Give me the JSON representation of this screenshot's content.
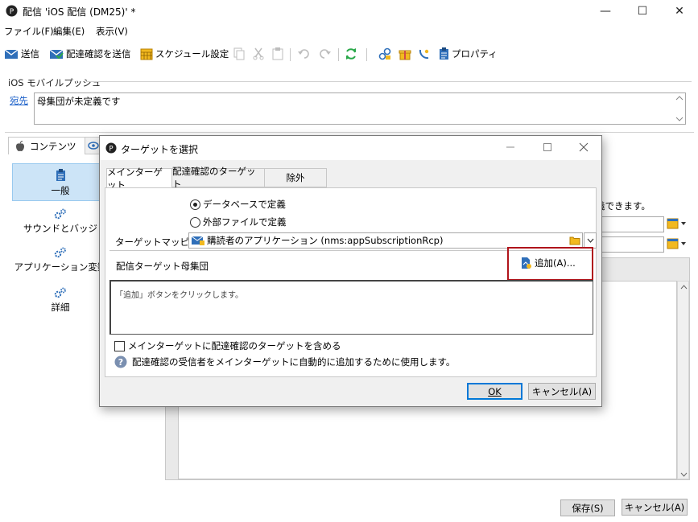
{
  "window": {
    "title": "配信 'iOS 配信 (DM25)' *",
    "minimize": "—",
    "maximize": "☐",
    "close": "✕"
  },
  "menu": [
    "ファイル(F)",
    "編集(E)",
    "表示(V)"
  ],
  "toolbar": {
    "send": "送信",
    "send_proof": "配達確認を送信",
    "schedule": "スケジュール設定",
    "properties": "プロパティ"
  },
  "section": {
    "title": "iOS モバイルプッシュ",
    "recipient_link": "宛先",
    "recipient_value": "母集団が未定義です"
  },
  "tabs": {
    "content": "コンテンツ"
  },
  "nav": [
    {
      "label": "一般",
      "icon": "clipboard-icon",
      "selected": true
    },
    {
      "label": "サウンドとバッジ",
      "icon": "gears-icon",
      "selected": false
    },
    {
      "label": "アプリケーション変数",
      "icon": "gears-icon",
      "selected": false
    },
    {
      "label": "詳細",
      "icon": "gears-icon",
      "selected": false
    }
  ],
  "background": {
    "hint_text": "義できます。"
  },
  "footer": {
    "save": "保存(S)",
    "cancel": "キャンセル(A)"
  },
  "dialog": {
    "title": "ターゲットを選択",
    "tabs": [
      "メインターゲット",
      "配達確認のターゲット",
      "除外"
    ],
    "active_tab": 0,
    "radio_db": "データベースで定義",
    "radio_file": "外部ファイルで定義",
    "radio_selected": "db",
    "mapping_label": "ターゲットマッピング:",
    "mapping_value": "購読者のアプリケーション (nms:appSubscriptionRcp)",
    "group_label": "配信ターゲット母集団",
    "add_button": "追加(A)...",
    "list_placeholder": "「追加」ボタンをクリックします。",
    "checkbox_label": "メインターゲットに配達確認のターゲットを含める",
    "checkbox_checked": false,
    "help_text": "配達確認の受信者をメインターゲットに自動的に追加するために使用します。",
    "ok": "OK",
    "cancel": "キャンセル(A)"
  },
  "colors": {
    "accent": "#0078d7",
    "highlight_box": "#b0141b",
    "link": "#1a5fc8",
    "nav_selected": "#cce4f7"
  }
}
